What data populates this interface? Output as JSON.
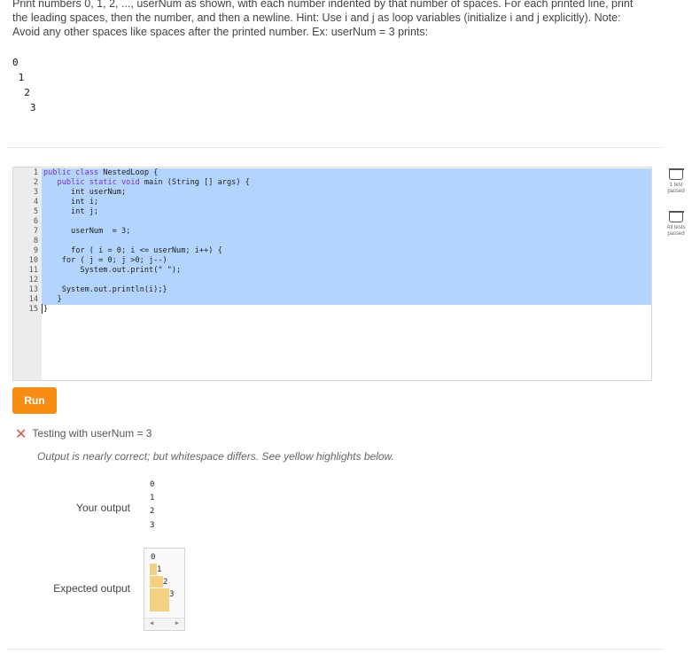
{
  "prompt": "Print numbers 0, 1, 2, ..., userNum as shown, with each number indented by that number of spaces. For each printed line, print the leading spaces, then the number, and then a newline. Hint: Use i and j as loop variables (initialize i and j explicitly). Note: Avoid any other spaces like spaces after the printed number. Ex: userNum = 3 prints:",
  "example_output": [
    "0",
    " 1",
    "  2",
    "   3"
  ],
  "editor": {
    "lines": [
      {
        "n": "1",
        "indent": "",
        "kw": "public class",
        "rest": " NestedLoop {"
      },
      {
        "n": "2",
        "indent": "   ",
        "kw": "public static void",
        "rest": " main (String [] args) {"
      },
      {
        "n": "3",
        "indent": "      ",
        "kw": "",
        "rest": "int userNum;"
      },
      {
        "n": "4",
        "indent": "      ",
        "kw": "",
        "rest": "int i;"
      },
      {
        "n": "5",
        "indent": "      ",
        "kw": "",
        "rest": "int j;"
      },
      {
        "n": "6",
        "indent": "",
        "kw": "",
        "rest": ""
      },
      {
        "n": "7",
        "indent": "      ",
        "kw": "",
        "rest": "userNum  = 3;"
      },
      {
        "n": "8",
        "indent": "",
        "kw": "",
        "rest": ""
      },
      {
        "n": "9",
        "indent": "      ",
        "kw": "",
        "rest": "for ( i = 0; i <= userNum; i++) {"
      },
      {
        "n": "10",
        "indent": "    ",
        "kw": "",
        "rest": "for ( j = 0; j >0; j--)"
      },
      {
        "n": "11",
        "indent": "        ",
        "kw": "",
        "rest": "System.out.print(\" \");"
      },
      {
        "n": "12",
        "indent": "",
        "kw": "",
        "rest": ""
      },
      {
        "n": "13",
        "indent": "    ",
        "kw": "",
        "rest": "System.out.println(i);}"
      },
      {
        "n": "14",
        "indent": "   ",
        "kw": "",
        "rest": "}"
      },
      {
        "n": "15",
        "indent": "",
        "kw": "",
        "rest": "}"
      }
    ]
  },
  "side": {
    "test1_label": "1 test passed",
    "all_label": "All tests passed"
  },
  "run_label": "Run",
  "result": {
    "title": "Testing with userNum = 3",
    "note": "Output is nearly correct; but whitespace differs. See yellow highlights below.",
    "your_label": "Your output",
    "expected_label": "Expected output",
    "your_output": [
      "0",
      "1",
      "2",
      "3"
    ],
    "expected_output": [
      "0",
      "1",
      "2",
      "3"
    ]
  },
  "colors": {
    "accent": "#f68c13",
    "selection": "#b3d4fd",
    "highlight": "#f5d281",
    "error": "#d9534f"
  }
}
